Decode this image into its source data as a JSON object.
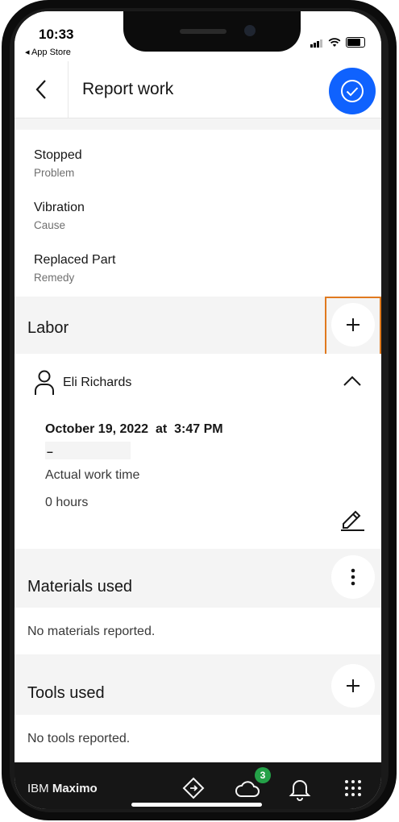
{
  "status_bar": {
    "time": "10:33",
    "back_app": "◂ App Store"
  },
  "header": {
    "title": "Report work"
  },
  "failure_fields": [
    {
      "value": "Stopped",
      "label": "Problem"
    },
    {
      "value": "Vibration",
      "label": "Cause"
    },
    {
      "value": "Replaced Part",
      "label": "Remedy"
    }
  ],
  "labor": {
    "section_title": "Labor",
    "person_name": "Eli Richards",
    "date": "October 19, 2022",
    "at": "at",
    "time": "3:47 PM",
    "end_dash": "–",
    "actual_work_time_label": "Actual work time",
    "actual_work_time_value": "0 hours"
  },
  "materials": {
    "section_title": "Materials used",
    "empty_text": "No materials reported."
  },
  "tools": {
    "section_title": "Tools used",
    "empty_text": "No tools reported."
  },
  "bottom_bar": {
    "brand_prefix": "IBM",
    "brand_name": "Maximo",
    "sync_badge_count": "3",
    "icons": [
      "navigation-icon",
      "cloud-sync-icon",
      "notification-bell-icon",
      "app-grid-icon"
    ]
  },
  "colors": {
    "primary_blue": "#0f62fe",
    "highlight_orange": "#e07a1f",
    "badge_green": "#24a148",
    "bottom_bar_bg": "#161616",
    "section_bg": "#f4f4f4"
  }
}
